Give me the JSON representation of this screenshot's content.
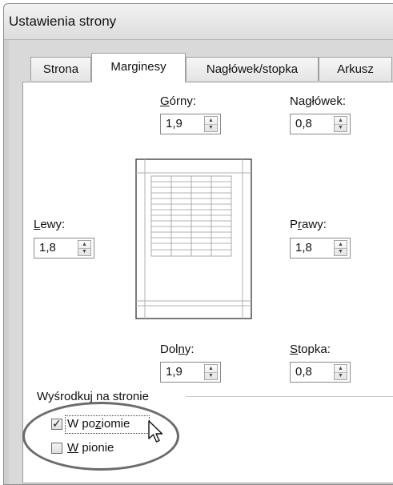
{
  "window": {
    "title": "Ustawienia strony"
  },
  "tabs": [
    {
      "label": "Strona",
      "active": false
    },
    {
      "label": "Marginesy",
      "active": true
    },
    {
      "label": "Nagłówek/stopka",
      "active": false
    },
    {
      "label": "Arkusz",
      "active": false
    }
  ],
  "margins": {
    "top": {
      "label_pre": "",
      "label_key": "G",
      "label_post": "órny:",
      "value": "1,9"
    },
    "header": {
      "label_pre": "Na",
      "label_key": "g",
      "label_post": "łówek:",
      "value": "0,8"
    },
    "left": {
      "label_pre": "",
      "label_key": "L",
      "label_post": "ewy:",
      "value": "1,8"
    },
    "right": {
      "label_pre": "P",
      "label_key": "r",
      "label_post": "awy:",
      "value": "1,8"
    },
    "bottom": {
      "label_pre": "Dol",
      "label_key": "n",
      "label_post": "y:",
      "value": "1,9"
    },
    "footer": {
      "label_pre": "",
      "label_key": "S",
      "label_post": "topka:",
      "value": "0,8"
    }
  },
  "center_on_page": {
    "group_label": "Wyśrodkuj na stronie",
    "horizontal": {
      "label_pre": "W po",
      "label_key": "z",
      "label_post": "iomie",
      "checked": true
    },
    "vertical": {
      "label_pre": "",
      "label_key": "W",
      "label_post": " pionie",
      "checked": false
    }
  },
  "icons": {
    "spin_up": "triangle-up-icon",
    "spin_down": "triangle-down-icon",
    "check": "checkmark-icon",
    "cursor": "mouse-pointer-icon"
  },
  "colors": {
    "window_bg": "#efefef",
    "panel_bg": "#ffffff",
    "border": "#9e9e9e",
    "annotation_oval": "#6b6b6b"
  }
}
